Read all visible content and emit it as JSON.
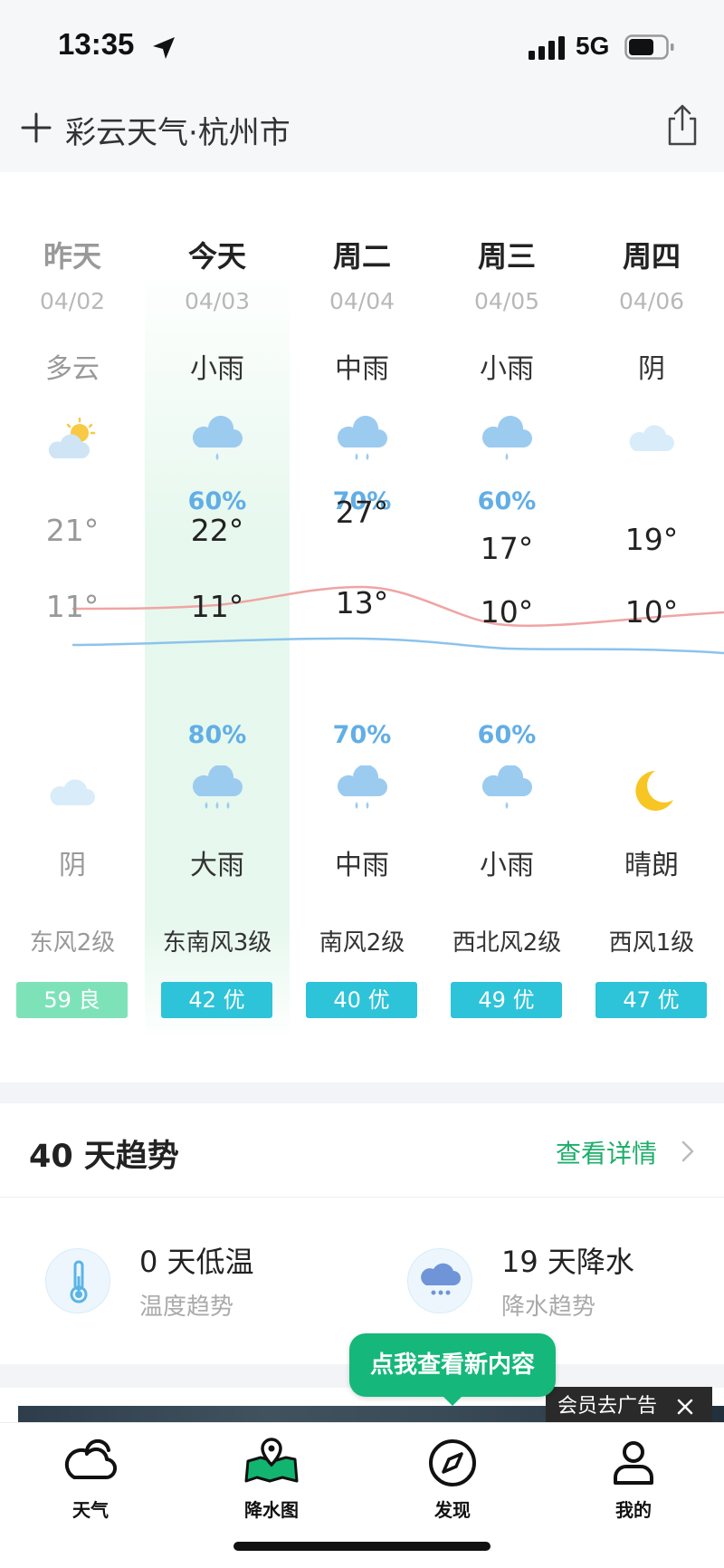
{
  "status_bar": {
    "time": "13:35",
    "network": "5G"
  },
  "header": {
    "title": "彩云天气·杭州市"
  },
  "forecast": [
    {
      "day": "昨天",
      "date": "04/02",
      "day_condition": "多云",
      "day_icon": "partly-cloudy-icon",
      "day_precip": "",
      "high": "21°",
      "low": "11°",
      "night_precip": "",
      "night_icon": "cloudy-icon",
      "night_condition": "阴",
      "wind": "东风2级",
      "aqi": "59 良",
      "past": true
    },
    {
      "day": "今天",
      "date": "04/03",
      "day_condition": "小雨",
      "day_icon": "light-rain-icon",
      "day_precip": "60%",
      "high": "22°",
      "low": "11°",
      "night_precip": "80%",
      "night_icon": "heavy-rain-icon",
      "night_condition": "大雨",
      "wind": "东南风3级",
      "aqi": "42 优",
      "past": false
    },
    {
      "day": "周二",
      "date": "04/04",
      "day_condition": "中雨",
      "day_icon": "moderate-rain-icon",
      "day_precip": "70%",
      "high": "27°",
      "low": "13°",
      "night_precip": "70%",
      "night_icon": "moderate-rain-icon",
      "night_condition": "中雨",
      "wind": "南风2级",
      "aqi": "40 优",
      "past": false
    },
    {
      "day": "周三",
      "date": "04/05",
      "day_condition": "小雨",
      "day_icon": "light-rain-icon",
      "day_precip": "60%",
      "high": "17°",
      "low": "10°",
      "night_precip": "60%",
      "night_icon": "light-rain-icon",
      "night_condition": "小雨",
      "wind": "西北风2级",
      "aqi": "49 优",
      "past": false
    },
    {
      "day": "周四",
      "date": "04/06",
      "day_condition": "阴",
      "day_icon": "cloudy-icon",
      "day_precip": "",
      "high": "19°",
      "low": "10°",
      "night_precip": "",
      "night_icon": "moon-icon",
      "night_condition": "晴朗",
      "wind": "西风1级",
      "aqi": "47 优",
      "past": false
    }
  ],
  "trend": {
    "title": "40 天趋势",
    "more_label": "查看详情",
    "items": [
      {
        "icon": "thermometer-icon",
        "main": "0 天低温",
        "sub": "温度趋势"
      },
      {
        "icon": "rain-cloud-icon",
        "main": "19 天降水",
        "sub": "降水趋势"
      }
    ]
  },
  "bubble": {
    "text": "点我查看新内容"
  },
  "ad": {
    "label": "会员去广告"
  },
  "tabs": [
    {
      "label": "天气",
      "icon": "weather-cloud-icon"
    },
    {
      "label": "降水图",
      "icon": "precip-map-icon"
    },
    {
      "label": "发现",
      "icon": "compass-icon"
    },
    {
      "label": "我的",
      "icon": "profile-icon"
    }
  ],
  "colors": {
    "accent": "#16b77a",
    "aqi_good": "#2dc3d8",
    "aqi_moderate": "#7ee2b8",
    "precip_text": "#62aee6",
    "high_line": "#f0a4a4",
    "low_line": "#8cc3ec"
  }
}
